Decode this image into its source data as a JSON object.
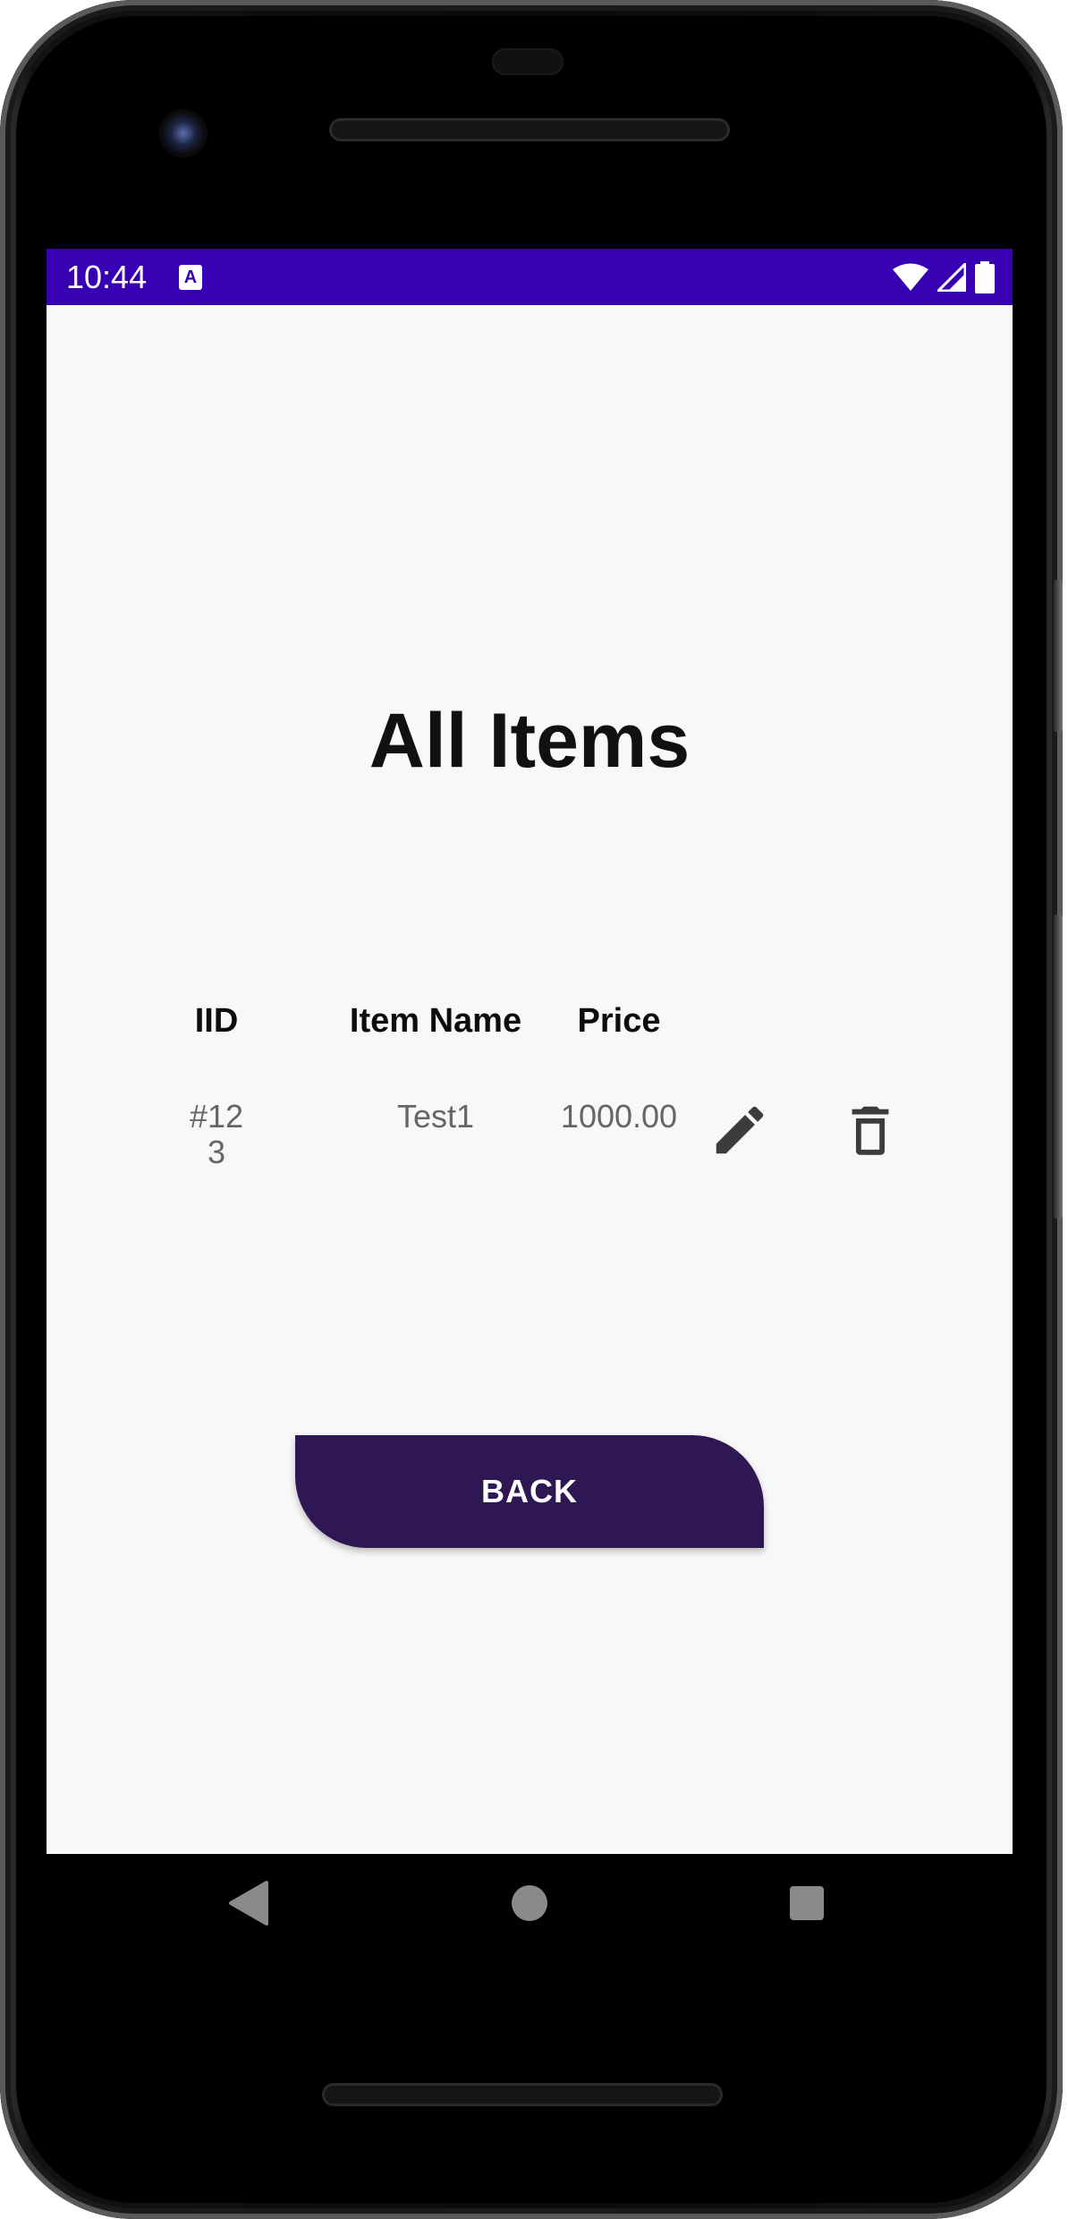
{
  "status_bar": {
    "time": "10:44",
    "notification_icon": "a-icon",
    "notification_letter": "A",
    "icons": [
      "wifi-icon",
      "signal-icon",
      "battery-icon"
    ],
    "color": "#3700b3"
  },
  "page": {
    "title": "All Items"
  },
  "table": {
    "headers": [
      "IID",
      "Item Name",
      "Price"
    ],
    "rows": [
      {
        "iid": "#123",
        "name": "Test1",
        "price": "1000.00",
        "actions": [
          "edit-icon",
          "delete-icon"
        ]
      }
    ]
  },
  "back_button": {
    "label": "BACK",
    "color": "#2e1752"
  },
  "nav_bar": {
    "items": [
      "back-triangle-icon",
      "home-circle-icon",
      "recents-square-icon"
    ]
  },
  "colors": {
    "screen_background": "#f8f8f8",
    "header_text": "#0d0d0d",
    "cell_text": "#666666",
    "icon": "#3c3c3c"
  }
}
